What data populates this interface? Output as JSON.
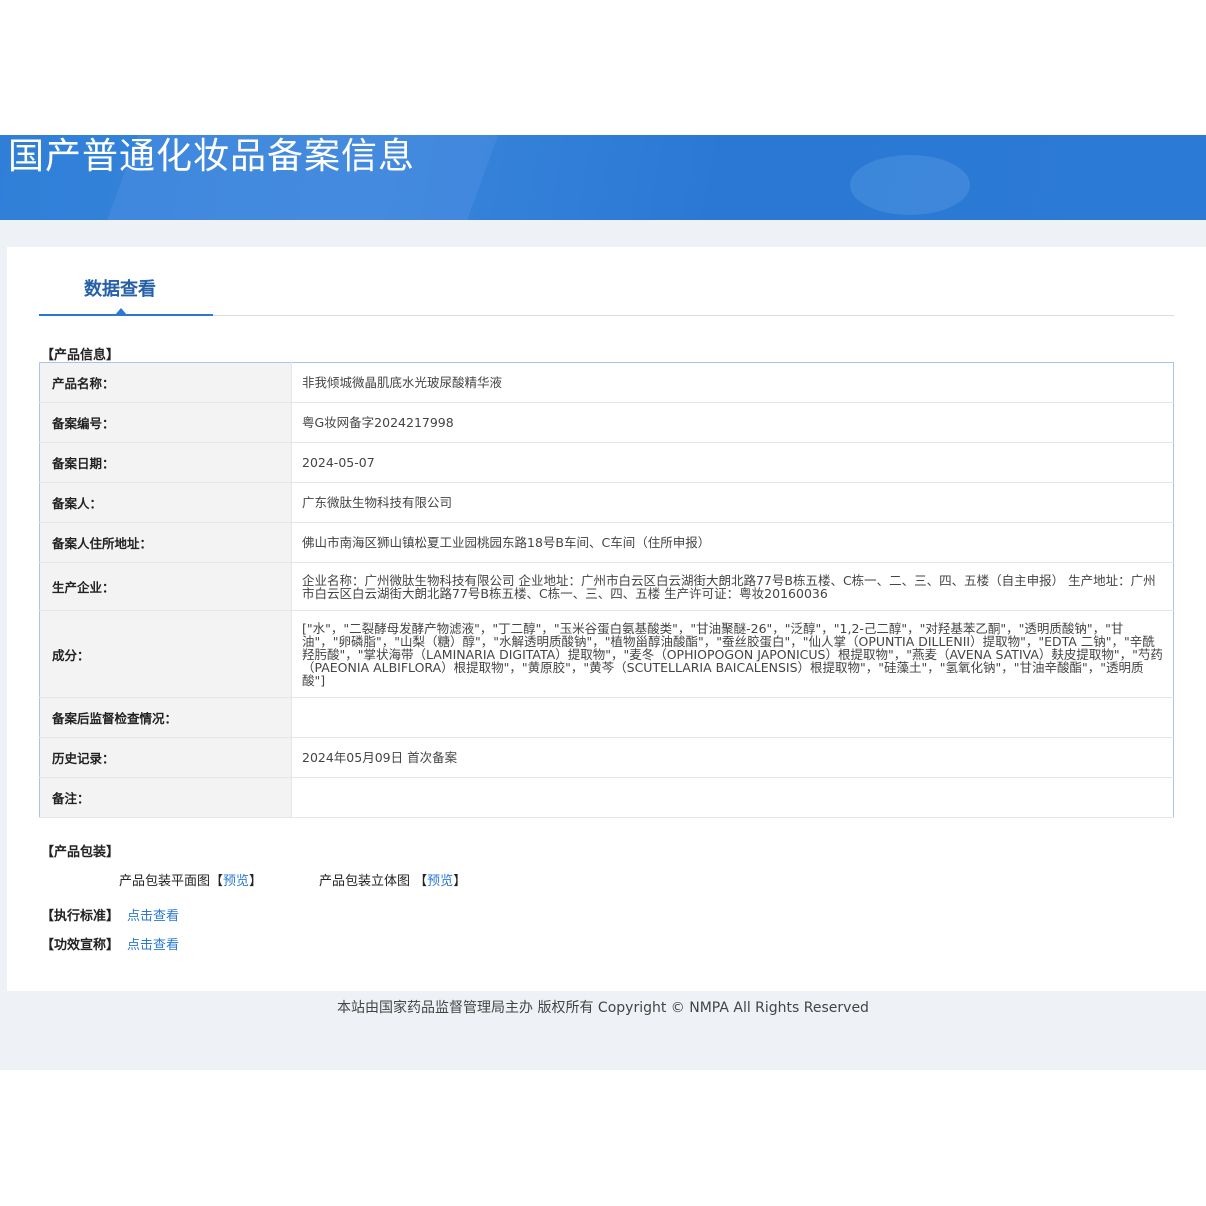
{
  "banner": {
    "title": "国产普通化妆品备案信息"
  },
  "tab": {
    "label": "数据查看"
  },
  "sections": {
    "product_info": "【产品信息】",
    "packaging": "【产品包装】",
    "standard": "【执行标准】",
    "efficacy": "【功效宣称】"
  },
  "product_info": [
    {
      "key": "产品名称：",
      "value": "非我倾城微晶肌底水光玻尿酸精华液"
    },
    {
      "key": "备案编号：",
      "value": "粤G妆网备字2024217998"
    },
    {
      "key": "备案日期：",
      "value": "2024-05-07"
    },
    {
      "key": "备案人：",
      "value": "广东微肽生物科技有限公司"
    },
    {
      "key": "备案人住所地址：",
      "value": "佛山市南海区狮山镇松夏工业园桃园东路18号B车间、C车间（住所申报）"
    },
    {
      "key": "生产企业：",
      "value": "企业名称：广州微肽生物科技有限公司 企业地址：广州市白云区白云湖街大朗北路77号B栋五楼、C栋一、二、三、四、五楼（自主申报） 生产地址：广州市白云区白云湖街大朗北路77号B栋五楼、C栋一、三、四、五楼 生产许可证：粤妆20160036"
    },
    {
      "key": "成分：",
      "value": "[\"水\"，\"二裂酵母发酵产物滤液\"，\"丁二醇\"，\"玉米谷蛋白氨基酸类\"，\"甘油聚醚-26\"，\"泛醇\"，\"1,2-己二醇\"，\"对羟基苯乙酮\"，\"透明质酸钠\"，\"甘油\"，\"卵磷脂\"，\"山梨（糖）醇\"，\"水解透明质酸钠\"，\"植物甾醇油酸酯\"，\"蚕丝胶蛋白\"，\"仙人掌（OPUNTIA DILLENII）提取物\"，\"EDTA 二钠\"，\"辛酰羟肟酸\"，\"掌状海带（LAMINARIA DIGITATA）提取物\"，\"麦冬（OPHIOPOGON JAPONICUS）根提取物\"，\"燕麦（AVENA SATIVA）麸皮提取物\"，\"芍药（PAEONIA ALBIFLORA）根提取物\"，\"黄原胶\"，\"黄芩（SCUTELLARIA BAICALENSIS）根提取物\"，\"硅藻土\"，\"氢氧化钠\"，\"甘油辛酸酯\"，\"透明质酸\"]"
    },
    {
      "key": "备案后监督检查情况：",
      "value": ""
    },
    {
      "key": "历史记录：",
      "value": "2024年05月09日 首次备案"
    },
    {
      "key": "备注：",
      "value": ""
    }
  ],
  "packaging": {
    "flat_label": "产品包装平面图",
    "flat_link": "预览",
    "solid_label": "产品包装立体图",
    "solid_link": "预览",
    "bracket_open": "【",
    "bracket_close": "】"
  },
  "view_link": "点击查看",
  "footer": "本站由国家药品监督管理局主办 版权所有 Copyright © NMPA All Rights Reserved"
}
